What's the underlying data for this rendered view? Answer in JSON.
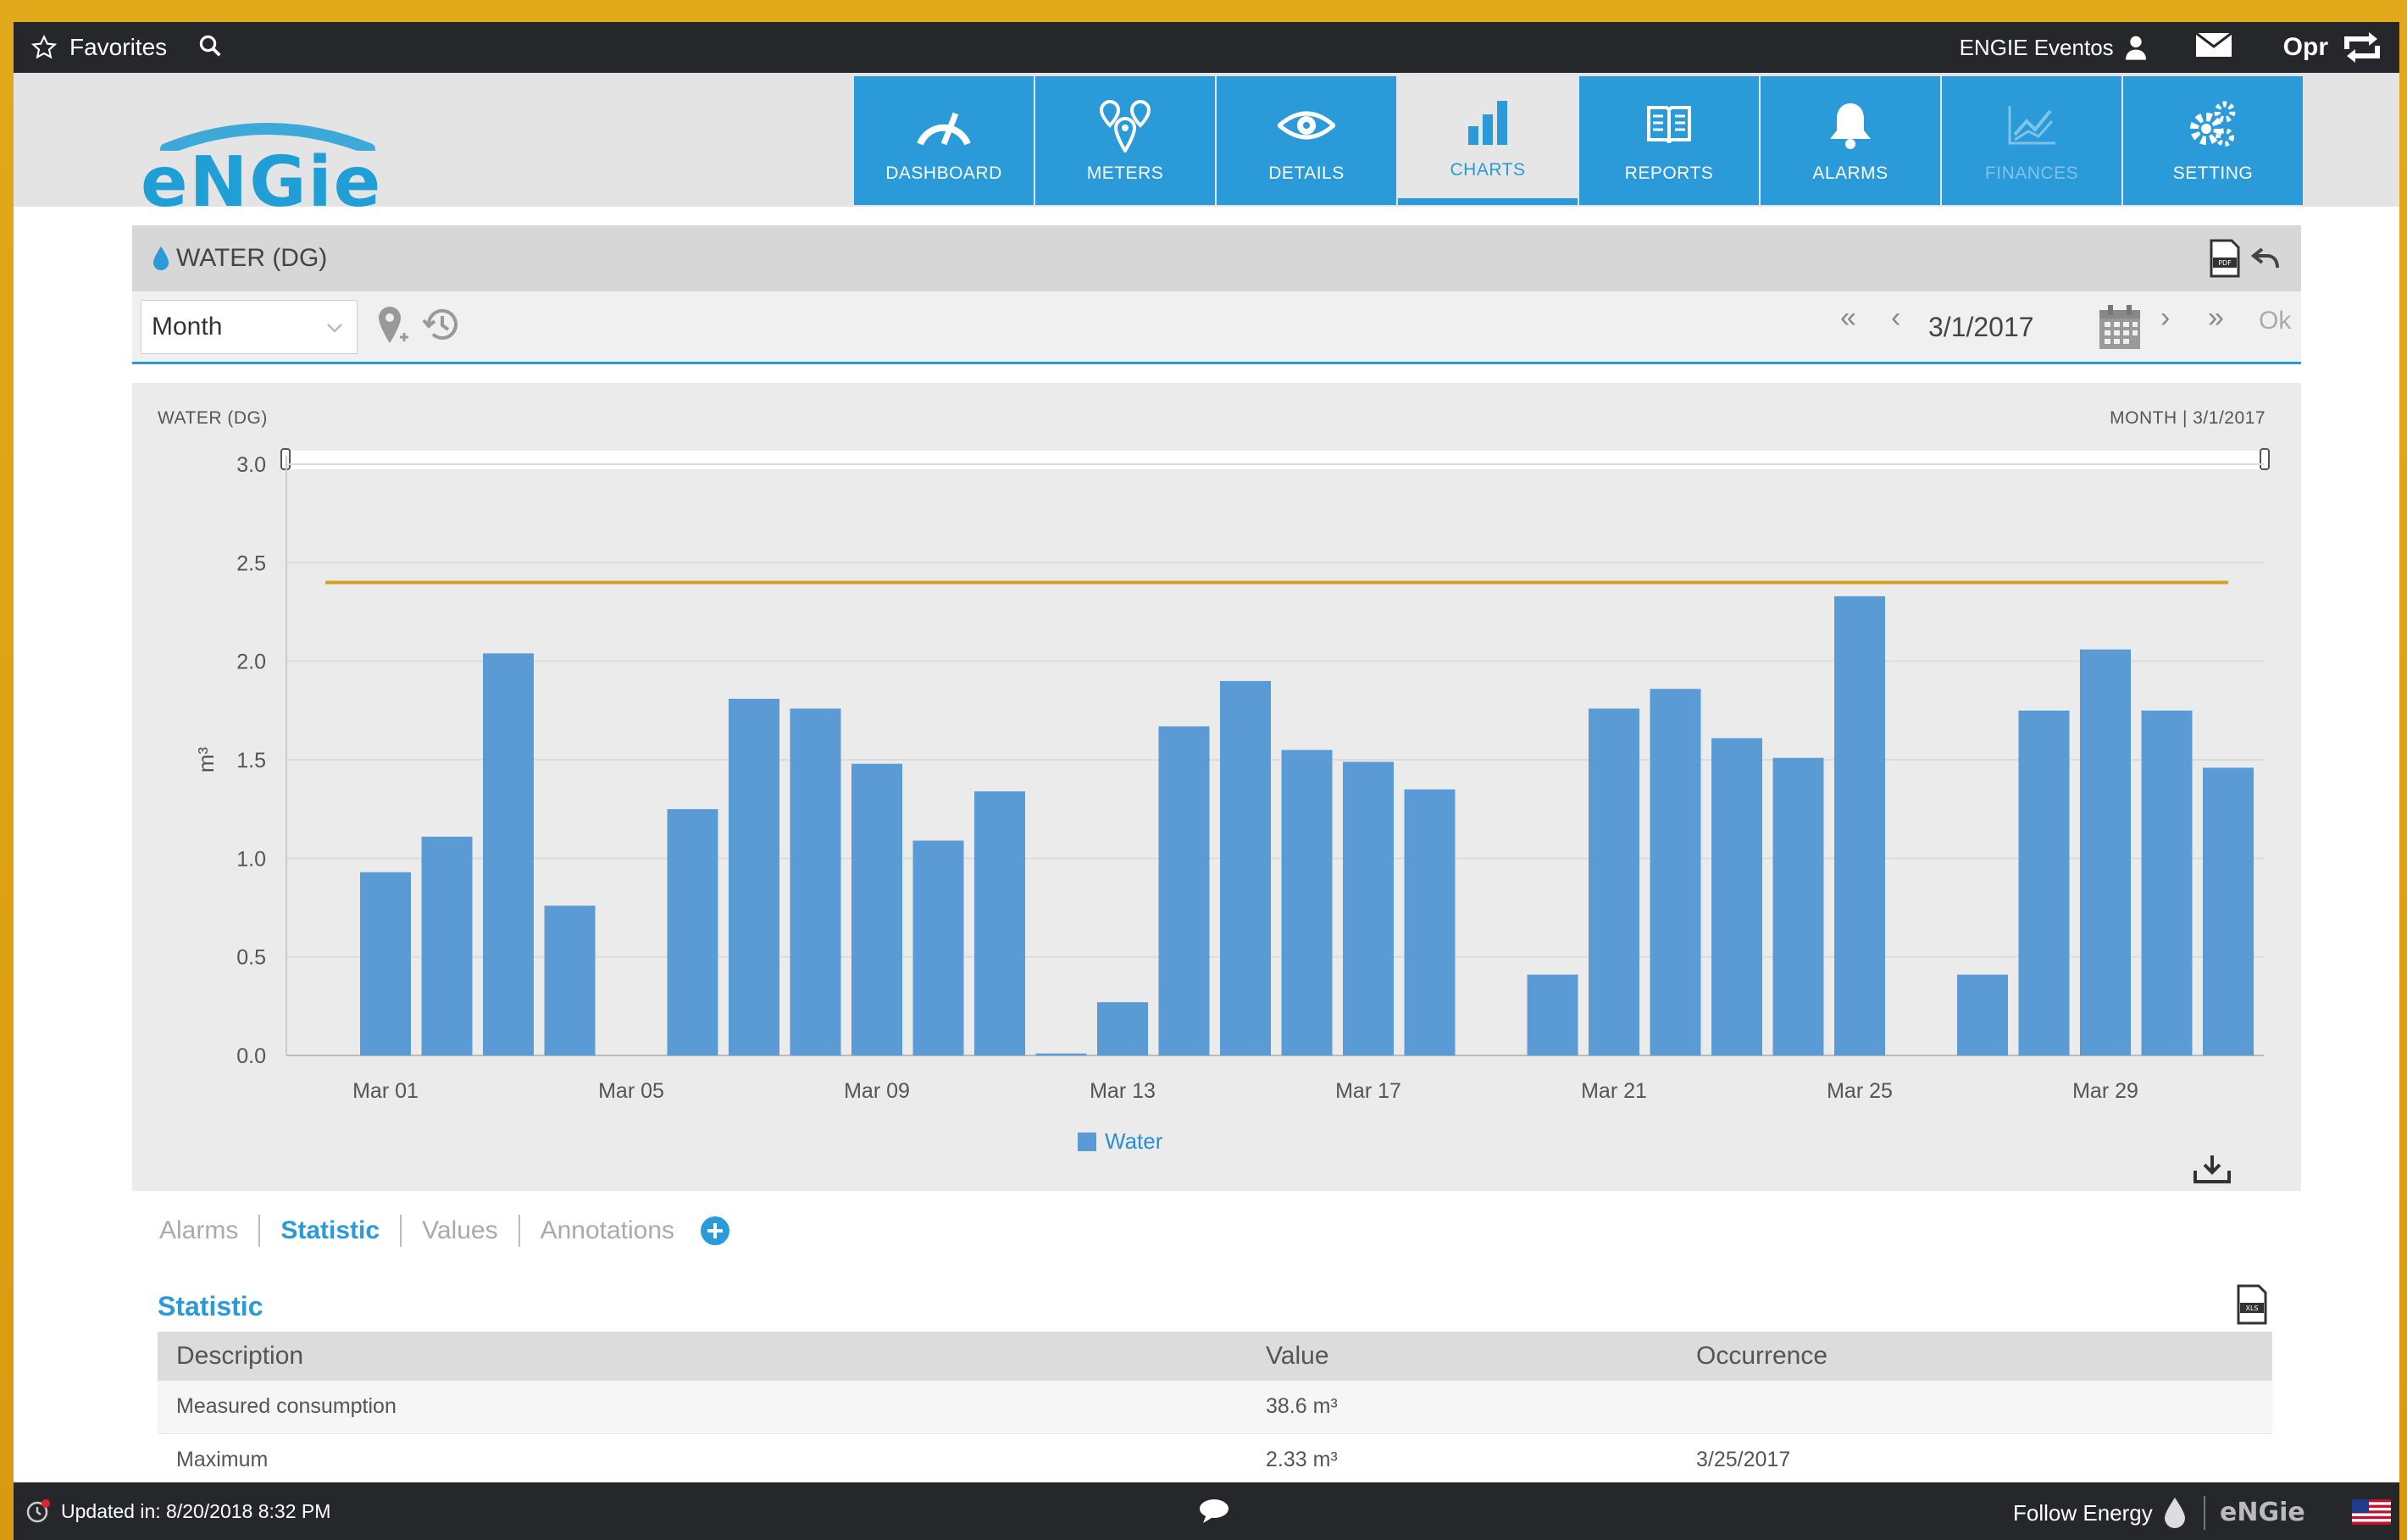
{
  "topbar": {
    "favorites_label": "Favorites",
    "user_label": "ENGIE Eventos",
    "opr_label": "Opr"
  },
  "header": {
    "logo_text": "ENGIE",
    "nav": [
      {
        "label": "DASHBOARD",
        "icon": "gauge-icon",
        "state": "normal"
      },
      {
        "label": "METERS",
        "icon": "map-pins-icon",
        "state": "normal"
      },
      {
        "label": "DETAILS",
        "icon": "eye-icon",
        "state": "normal"
      },
      {
        "label": "CHARTS",
        "icon": "bar-chart-icon",
        "state": "active"
      },
      {
        "label": "REPORTS",
        "icon": "book-icon",
        "state": "normal"
      },
      {
        "label": "ALARMS",
        "icon": "bell-icon",
        "state": "normal"
      },
      {
        "label": "FINANCES",
        "icon": "line-chart-icon",
        "state": "disabled"
      },
      {
        "label": "SETTING",
        "icon": "gears-icon",
        "state": "normal"
      }
    ]
  },
  "panel": {
    "title": "WATER (DG)",
    "period_value": "Month",
    "date_value": "3/1/2017",
    "ok_label": "Ok"
  },
  "chart_data": {
    "type": "bar",
    "title": "WATER (DG)",
    "subtitle": "MONTH | 3/1/2017",
    "ylabel": "m³",
    "xlabel": "",
    "ylim": [
      0,
      3.0
    ],
    "yticks": [
      "0.0",
      "0.5",
      "1.0",
      "1.5",
      "2.0",
      "2.5",
      "3.0"
    ],
    "x_tick_labels": [
      "Mar 01",
      "Mar 05",
      "Mar 09",
      "Mar 13",
      "Mar 17",
      "Mar 21",
      "Mar 25",
      "Mar 29"
    ],
    "categories": [
      "Mar 01",
      "Mar 02",
      "Mar 03",
      "Mar 04",
      "Mar 05",
      "Mar 06",
      "Mar 07",
      "Mar 08",
      "Mar 09",
      "Mar 10",
      "Mar 11",
      "Mar 12",
      "Mar 13",
      "Mar 14",
      "Mar 15",
      "Mar 16",
      "Mar 17",
      "Mar 18",
      "Mar 19",
      "Mar 20",
      "Mar 21",
      "Mar 22",
      "Mar 23",
      "Mar 24",
      "Mar 25",
      "Mar 26",
      "Mar 27",
      "Mar 28",
      "Mar 29",
      "Mar 30",
      "Mar 31"
    ],
    "series": [
      {
        "name": "Water",
        "color": "#5b9bd5",
        "values": [
          0.93,
          1.11,
          2.04,
          0.76,
          0,
          1.25,
          1.81,
          1.76,
          1.48,
          1.09,
          1.34,
          0.01,
          0.27,
          1.67,
          1.9,
          1.55,
          1.49,
          1.35,
          0,
          0.41,
          1.76,
          1.86,
          1.61,
          1.51,
          2.33,
          0,
          0.41,
          1.75,
          2.06,
          1.75,
          1.46
        ]
      }
    ],
    "reference_line": {
      "value": 2.4,
      "color": "#d4a020"
    },
    "legend": [
      "Water"
    ],
    "grid": true
  },
  "tabs": [
    {
      "label": "Alarms",
      "active": false
    },
    {
      "label": "Statistic",
      "active": true
    },
    {
      "label": "Values",
      "active": false
    },
    {
      "label": "Annotations",
      "active": false
    }
  ],
  "statistic": {
    "title": "Statistic",
    "columns": [
      "Description",
      "Value",
      "Occurrence"
    ],
    "rows": [
      [
        "Measured consumption",
        "38.6 m³",
        ""
      ],
      [
        "Maximum",
        "2.33 m³",
        "3/25/2017"
      ]
    ]
  },
  "statusbar": {
    "updated_text": "Updated in: 8/20/2018 8:32 PM",
    "follow_label": "Follow Energy",
    "logo_text": "ENGIE"
  },
  "colors": {
    "accent": "#2a9ad8",
    "bar": "#5b9bd5",
    "reference": "#d4a020",
    "dark_bar": "#26272a"
  }
}
